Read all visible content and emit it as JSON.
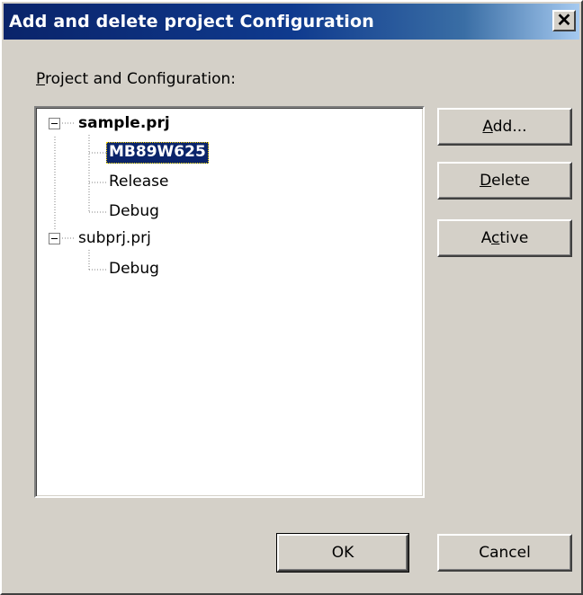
{
  "window": {
    "title": "Add and delete project Configuration",
    "close_glyph": "✕"
  },
  "group": {
    "label_accel": "P",
    "label_rest": "roject and Configuration:"
  },
  "tree": {
    "nodes": [
      {
        "label": "sample.prj",
        "level": 0,
        "expanded": true,
        "bold": true
      },
      {
        "label": "MB89W625",
        "level": 1,
        "selected": true
      },
      {
        "label": "Release",
        "level": 1
      },
      {
        "label": "Debug",
        "level": 1
      },
      {
        "label": "subprj.prj",
        "level": 0,
        "expanded": true
      },
      {
        "label": "Debug",
        "level": 1
      }
    ]
  },
  "buttons": {
    "add_accel": "A",
    "add_rest": "dd...",
    "delete_accel": "D",
    "delete_rest": "elete",
    "active_pre": "A",
    "active_accel": "c",
    "active_rest": "tive",
    "ok": "OK",
    "cancel": "Cancel"
  },
  "icons": {
    "close": "close-icon",
    "expander": "minus-box-icon"
  }
}
